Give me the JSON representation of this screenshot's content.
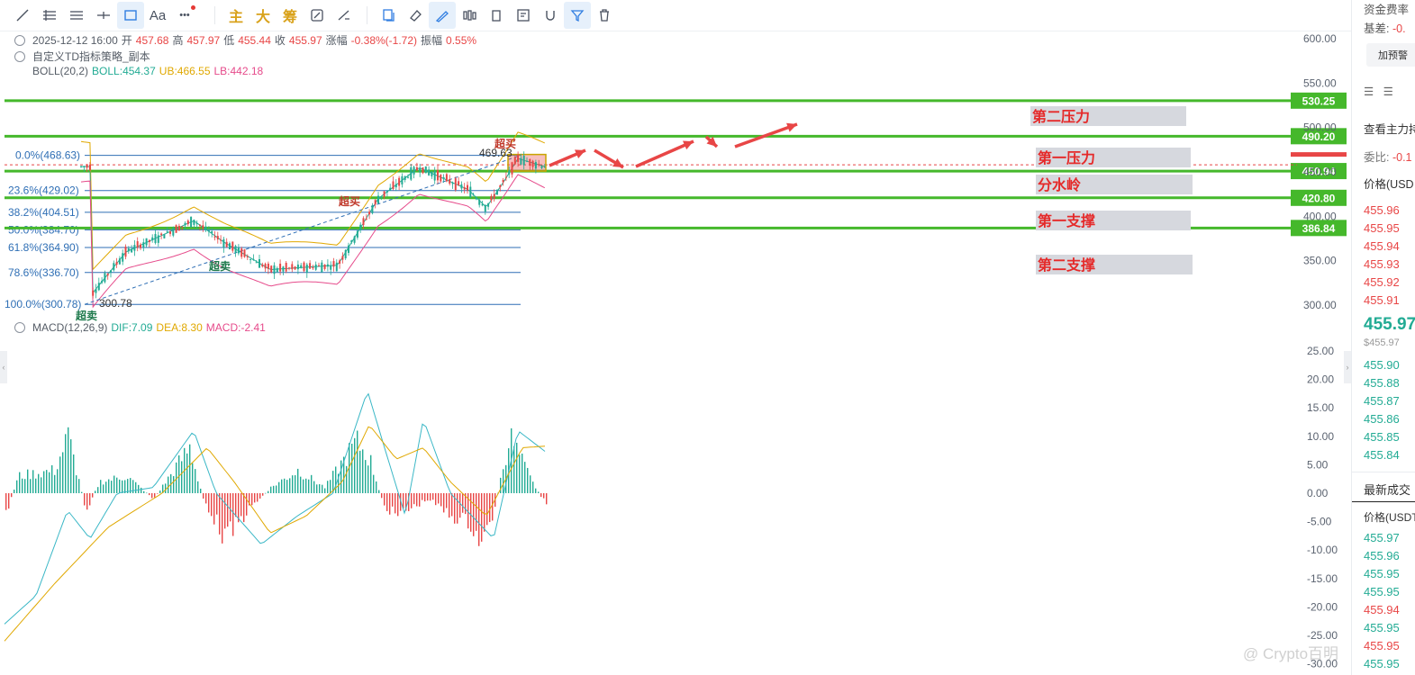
{
  "toolbar": {
    "text_tool": "Aa",
    "more": "•••",
    "main": "主",
    "big": "大",
    "chips": "筹"
  },
  "legend": {
    "datetime": "2025-12-12 16:00",
    "open_label": "开",
    "open": "457.68",
    "high_label": "高",
    "high": "457.97",
    "low_label": "低",
    "low": "455.44",
    "close_label": "收",
    "close": "455.97",
    "change_label": "涨幅",
    "change": "-0.38%(-1.72)",
    "amp_label": "振幅",
    "amp": "0.55%",
    "strategy": "自定义TD指标策略_副本",
    "boll_name": "BOLL(20,2)",
    "boll_mid": "BOLL:454.37",
    "boll_ub": "UB:466.55",
    "boll_lb": "LB:442.18",
    "macd_name": "MACD(12,26,9)",
    "macd_dif": "DIF:7.09",
    "macd_dea": "DEA:8.30",
    "macd_val": "MACD:-2.41"
  },
  "colors": {
    "green_level": "#45b82b",
    "up": "#e84646",
    "down": "#22ab94",
    "fib": "#2f6fb5",
    "zone": "#d6d8de",
    "zone_text": "#e52a2a"
  },
  "chart_data": [
    {
      "type": "candlestick",
      "y_axis": {
        "range": [
          290,
          610
        ],
        "ticks": [
          "600.00",
          "550.00",
          "500.00",
          "450.00",
          "400.00",
          "350.00",
          "300.00"
        ]
      },
      "levels": [
        {
          "value": 530.25,
          "label": "530.25",
          "zone": ""
        },
        {
          "value": 490.2,
          "label": "490.20",
          "zone": "第二压力"
        },
        {
          "value": 450.94,
          "label": "450.94",
          "zone": "第一压力",
          "current": true
        },
        {
          "value": 420.8,
          "label": "420.80",
          "zone": "分水岭"
        },
        {
          "value": 386.84,
          "label": "386.84",
          "zone": "第一支撑"
        },
        {
          "value": 350.0,
          "label": "",
          "zone": "第二支撑"
        }
      ],
      "fibonacci": [
        {
          "value": 468.63,
          "label": "0.0%(468.63)"
        },
        {
          "value": 429.02,
          "label": "23.6%(429.02)"
        },
        {
          "value": 404.51,
          "label": "38.2%(404.51)"
        },
        {
          "value": 384.7,
          "label": "50.0%(384.70)"
        },
        {
          "value": 364.9,
          "label": "61.8%(364.90)"
        },
        {
          "value": 336.7,
          "label": "78.6%(336.70)"
        },
        {
          "value": 300.78,
          "label": "100.0%(300.78)"
        }
      ],
      "markers": [
        {
          "text": "超卖",
          "near": 300.78
        },
        {
          "text": "超卖",
          "near": 340
        },
        {
          "text": "超买",
          "near": 415
        },
        {
          "text": "超买",
          "near": 476
        }
      ],
      "price_labels": {
        "high": "469.63",
        "low": "300.78"
      },
      "close": 455.97
    },
    {
      "type": "macd",
      "y_axis": {
        "range": [
          -31,
          28
        ],
        "ticks": [
          "25.00",
          "20.00",
          "15.00",
          "10.00",
          "5.00",
          "0.00",
          "-5.00",
          "-10.00",
          "-15.00",
          "-20.00",
          "-25.00",
          "-30.00"
        ]
      },
      "dif": 7.09,
      "dea": 8.3,
      "macd": -2.41
    }
  ],
  "sidebar": {
    "funding_rate": "资金费率",
    "basis": "基差:",
    "basis_val": "-0.",
    "alert_btn": "加预警",
    "view_main": "查看主力持",
    "ratio_label": "委比:",
    "ratio_val": "-0.1",
    "price_header": "价格(USD",
    "asks": [
      "455.96",
      "455.95",
      "455.94",
      "455.93",
      "455.92",
      "455.91"
    ],
    "last_price": "455.97",
    "last_usd": "$455.97",
    "bids": [
      "455.90",
      "455.88",
      "455.87",
      "455.86",
      "455.85",
      "455.84"
    ],
    "trades_title": "最新成交",
    "trades_header": "价格(USDT",
    "trades": [
      {
        "p": "455.97",
        "side": "buy"
      },
      {
        "p": "455.96",
        "side": "buy"
      },
      {
        "p": "455.95",
        "side": "buy"
      },
      {
        "p": "455.95",
        "side": "buy"
      },
      {
        "p": "455.94",
        "side": "sell"
      },
      {
        "p": "455.95",
        "side": "buy"
      },
      {
        "p": "455.95",
        "side": "sell"
      },
      {
        "p": "455.95",
        "side": "buy"
      }
    ]
  },
  "watermark": "@ Crypto百明"
}
